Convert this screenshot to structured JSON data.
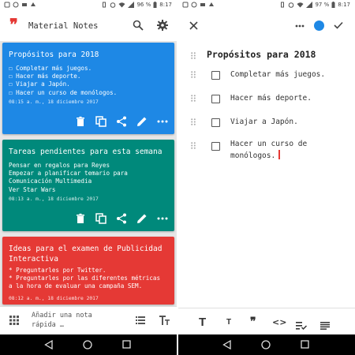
{
  "left": {
    "status": {
      "battery": "96 %",
      "time": "8:17"
    },
    "app_title": "Material Notes",
    "notes": [
      {
        "title": "Propósitos para 2018",
        "lines": [
          "☐ Completar más juegos.",
          "☐ Hacer más deporte.",
          "☐ Viajar a Japón.",
          "☐ Hacer un curso de monólogos."
        ],
        "date": "08:15 a. m., 18 diciembre 2017",
        "color": "#1e88e5"
      },
      {
        "title": "Tareas pendientes para esta semana",
        "lines": [
          "Pensar en regalos para Reyes",
          "Empezar a planificar temario para",
          "Comunicación Multimedia",
          "Ver Star Wars"
        ],
        "date": "08:13 a. m., 18 diciembre 2017",
        "color": "#00897b"
      },
      {
        "title_lines": [
          "Ideas para el examen de Publicidad",
          "Interactiva"
        ],
        "lines": [
          "* Preguntarles por Twitter.",
          "* Preguntarles por las diferentes métricas",
          "a la hora de evaluar una campaña SEM."
        ],
        "date": "08:12 a. m., 18 diciembre 2017",
        "color": "#e53935"
      }
    ],
    "quick_note_lines": [
      "Añadir una nota",
      "rápida …"
    ]
  },
  "right": {
    "status": {
      "battery": "97 %",
      "time": "8:17"
    },
    "title": "Propósitos para 2018",
    "items": [
      "Completar más juegos.",
      "Hacer más deporte.",
      "Viajar a Japón.",
      "Hacer un curso de"
    ],
    "item4_line2": "monólogos.",
    "accent": "#1e88e5"
  }
}
